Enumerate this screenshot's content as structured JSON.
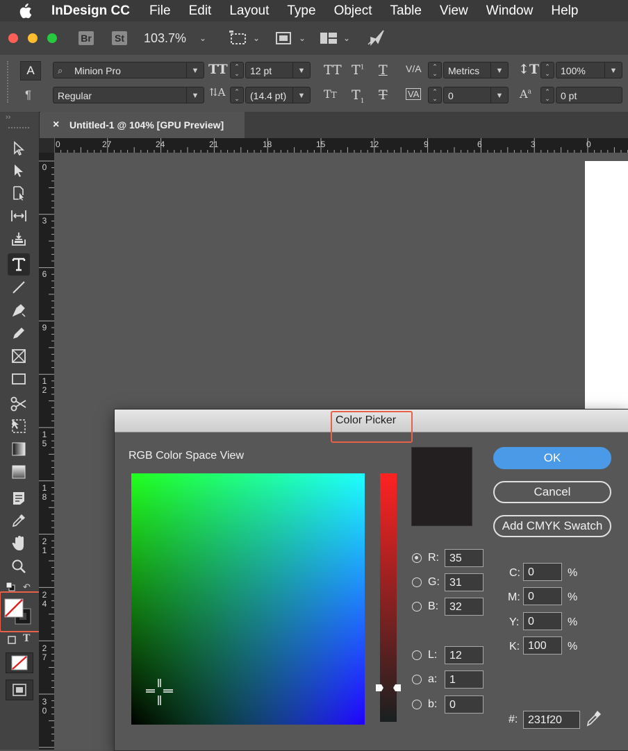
{
  "menubar": {
    "app_name": "InDesign CC",
    "items": [
      "File",
      "Edit",
      "Layout",
      "Type",
      "Object",
      "Table",
      "View",
      "Window",
      "Help"
    ]
  },
  "appbar": {
    "bridge": "Br",
    "stock": "St",
    "zoom": "103.7%"
  },
  "control": {
    "font_family": "Minion Pro",
    "font_style": "Regular",
    "font_size": "12 pt",
    "leading": "(14.4 pt)",
    "kerning": "Metrics",
    "tracking": "0",
    "vertical_scale": "100%",
    "baseline_shift": "0 pt"
  },
  "document_tab": {
    "close": "×",
    "title": "Untitled-1 @ 104% [GPU Preview]"
  },
  "rulers": {
    "horizontal": [
      "0",
      "27",
      "24",
      "21",
      "18",
      "15",
      "12",
      "9",
      "6",
      "3",
      "0"
    ],
    "vertical": [
      "0",
      "3",
      "6",
      "9",
      "12",
      "15",
      "18",
      "21",
      "24",
      "27",
      "30"
    ]
  },
  "color_picker": {
    "title": "Color Picker",
    "space_label": "RGB Color Space View",
    "buttons": {
      "ok": "OK",
      "cancel": "Cancel",
      "add_swatch": "Add CMYK Swatch"
    },
    "rgb": {
      "R": "35",
      "G": "31",
      "B": "32"
    },
    "lab": {
      "L": "12",
      "a": "1",
      "b": "0"
    },
    "cmyk": {
      "C": "0",
      "M": "0",
      "Y": "0",
      "K": "100"
    },
    "percent": "%",
    "hex_label": "#:",
    "hex": "231f20",
    "preview_color": "#231f20",
    "slider_level": 0.14
  },
  "colors": {
    "highlight": "#e6604a",
    "accent": "#4b9ae8"
  }
}
